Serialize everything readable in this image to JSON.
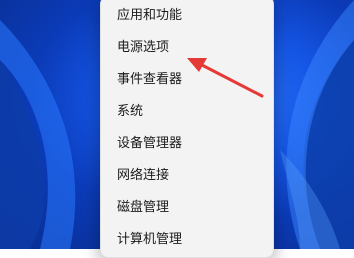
{
  "context_menu": {
    "items": [
      {
        "label": "应用和功能"
      },
      {
        "label": "电源选项"
      },
      {
        "label": "事件查看器"
      },
      {
        "label": "系统"
      },
      {
        "label": "设备管理器"
      },
      {
        "label": "网络连接"
      },
      {
        "label": "磁盘管理"
      },
      {
        "label": "计算机管理"
      }
    ]
  },
  "annotation": {
    "icon": "red-arrow-icon",
    "color": "#e53935"
  },
  "colors": {
    "menu_bg": "#f3f3f3",
    "desktop_blue": "#1556e6"
  }
}
